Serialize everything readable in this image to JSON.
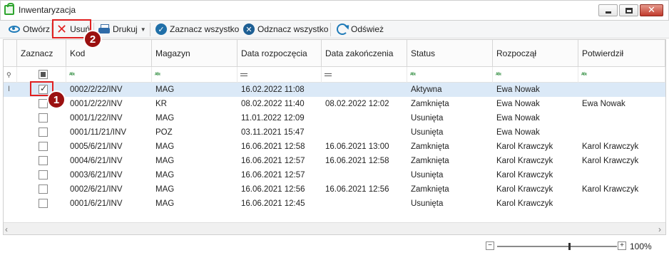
{
  "window": {
    "title": "Inwentaryzacja",
    "close_glyph": "✕"
  },
  "toolbar": {
    "open_label": "Otwórz",
    "delete_label": "Usuń",
    "print_label": "Drukuj",
    "select_all_label": "Zaznacz wszystko",
    "deselect_all_label": "Odznacz wszystko",
    "refresh_label": "Odśwież"
  },
  "columns": [
    "Zaznacz",
    "Kod",
    "Magazyn",
    "Data rozpoczęcia",
    "Data zakończenia",
    "Status",
    "Rozpoczął",
    "Potwierdził"
  ],
  "filter_icons": [
    "abc-icon",
    "abc-icon",
    "eq-icon",
    "eq-icon",
    "abc-icon",
    "abc-icon",
    "abc-icon"
  ],
  "rows": [
    {
      "checked": true,
      "kod": "0002/2/22/INV",
      "magazyn": "MAG",
      "start": "16.02.2022 11:08",
      "end": "",
      "status": "Aktywna",
      "rozpoczal": "Ewa Nowak",
      "potwierdzil": ""
    },
    {
      "checked": false,
      "kod": "0001/2/22/INV",
      "magazyn": "KR",
      "start": "08.02.2022 11:40",
      "end": "08.02.2022 12:02",
      "status": "Zamknięta",
      "rozpoczal": "Ewa Nowak",
      "potwierdzil": "Ewa Nowak"
    },
    {
      "checked": false,
      "kod": "0001/1/22/INV",
      "magazyn": "MAG",
      "start": "11.01.2022 12:09",
      "end": "",
      "status": "Usunięta",
      "rozpoczal": "Ewa Nowak",
      "potwierdzil": ""
    },
    {
      "checked": false,
      "kod": "0001/11/21/INV",
      "magazyn": "POZ",
      "start": "03.11.2021 15:47",
      "end": "",
      "status": "Usunięta",
      "rozpoczal": "Ewa Nowak",
      "potwierdzil": ""
    },
    {
      "checked": false,
      "kod": "0005/6/21/INV",
      "magazyn": "MAG",
      "start": "16.06.2021 12:58",
      "end": "16.06.2021 13:00",
      "status": "Zamknięta",
      "rozpoczal": "Karol Krawczyk",
      "potwierdzil": "Karol Krawczyk"
    },
    {
      "checked": false,
      "kod": "0004/6/21/INV",
      "magazyn": "MAG",
      "start": "16.06.2021 12:57",
      "end": "16.06.2021 12:58",
      "status": "Zamknięta",
      "rozpoczal": "Karol Krawczyk",
      "potwierdzil": "Karol Krawczyk"
    },
    {
      "checked": false,
      "kod": "0003/6/21/INV",
      "magazyn": "MAG",
      "start": "16.06.2021 12:57",
      "end": "",
      "status": "Usunięta",
      "rozpoczal": "Karol Krawczyk",
      "potwierdzil": ""
    },
    {
      "checked": false,
      "kod": "0002/6/21/INV",
      "magazyn": "MAG",
      "start": "16.06.2021 12:56",
      "end": "16.06.2021 12:56",
      "status": "Zamknięta",
      "rozpoczal": "Karol Krawczyk",
      "potwierdzil": "Karol Krawczyk"
    },
    {
      "checked": false,
      "kod": "0001/6/21/INV",
      "magazyn": "MAG",
      "start": "16.06.2021 12:45",
      "end": "",
      "status": "Usunięta",
      "rozpoczal": "Karol Krawczyk",
      "potwierdzil": ""
    }
  ],
  "zoom": {
    "minus": "−",
    "plus": "+",
    "value": "100%",
    "level": 0.6
  },
  "annotations": {
    "badge1": "1",
    "badge2": "2"
  },
  "colors": {
    "selected_row": "#dbe9f7",
    "annotation_red": "#e02020",
    "badge": "#9b1010",
    "accent_blue": "#1e7ab8"
  }
}
